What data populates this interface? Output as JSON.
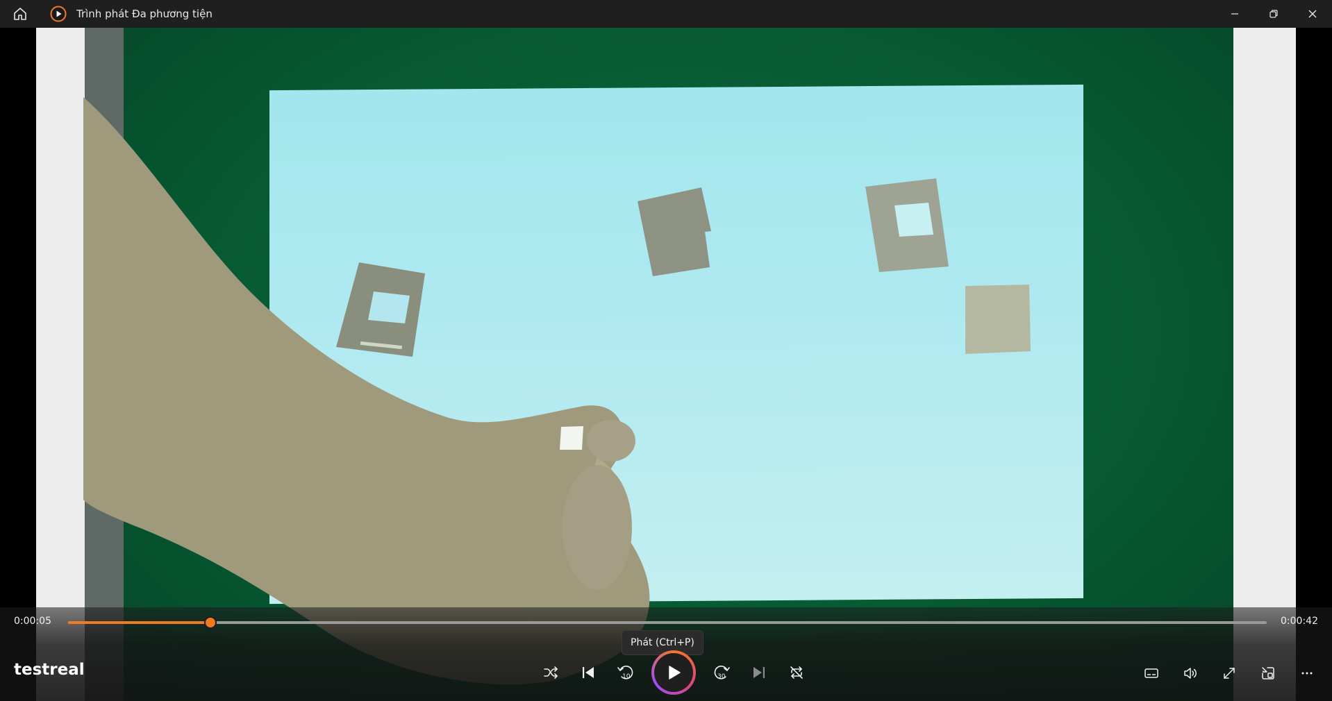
{
  "window": {
    "title": "Trình phát Đa phương tiện"
  },
  "icons": {
    "home": "home-icon",
    "app": "media-player-logo-icon",
    "minimize": "minimize-icon",
    "restore": "restore-icon",
    "close": "close-icon",
    "shuffle": "shuffle-icon",
    "previous": "previous-icon",
    "skip_back": "skip-back-10-icon",
    "play": "play-icon",
    "skip_forward": "skip-forward-30-icon",
    "next": "next-icon",
    "repeat": "repeat-icon",
    "captions": "captions-icon",
    "volume": "volume-icon",
    "fullscreen": "fullscreen-icon",
    "mini_player": "mini-player-icon",
    "more": "more-icon"
  },
  "player": {
    "media_title": "testreal",
    "elapsed": "0:00:05",
    "duration": "0:00:42",
    "progress_fraction": 0.119,
    "skip_back_seconds": "10",
    "skip_forward_seconds": "30",
    "play_tooltip": "Phát (Ctrl+P)"
  },
  "colors": {
    "accent": "#f27a24",
    "titlebar": "#1f1f1f"
  }
}
